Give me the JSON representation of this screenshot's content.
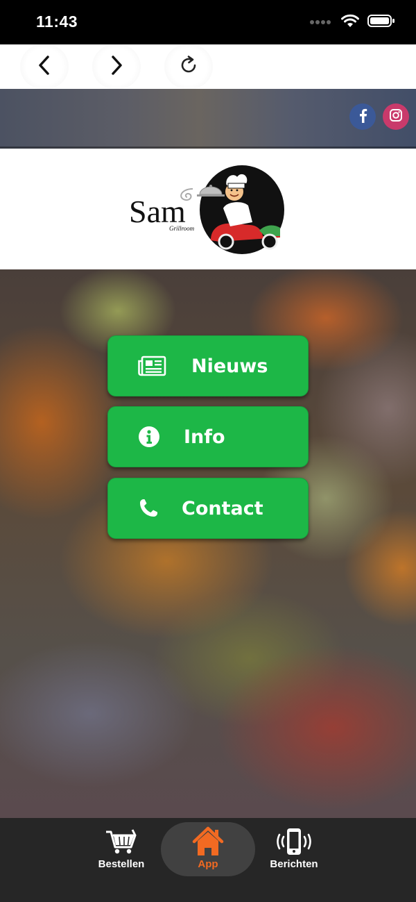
{
  "status_bar": {
    "time": "11:43"
  },
  "nav": {
    "back_icon": "chevron-left",
    "forward_icon": "chevron-right",
    "reload_icon": "reload"
  },
  "social": {
    "facebook_icon": "facebook",
    "instagram_icon": "instagram"
  },
  "logo": {
    "name": "Sam",
    "tagline": "Grillroom"
  },
  "menu": {
    "items": [
      {
        "label": "Nieuws",
        "icon": "newspaper"
      },
      {
        "label": "Info",
        "icon": "info-circle"
      },
      {
        "label": "Contact",
        "icon": "phone"
      }
    ]
  },
  "tabbar": {
    "items": [
      {
        "label": "Bestellen",
        "icon": "cart"
      },
      {
        "label": "App",
        "icon": "home",
        "active": true
      },
      {
        "label": "Berichten",
        "icon": "phone-vibrate"
      }
    ]
  },
  "colors": {
    "button_green": "#1db747",
    "active_tab": "#f26a22",
    "facebook": "#3b5998",
    "instagram": "#c93a6b"
  }
}
